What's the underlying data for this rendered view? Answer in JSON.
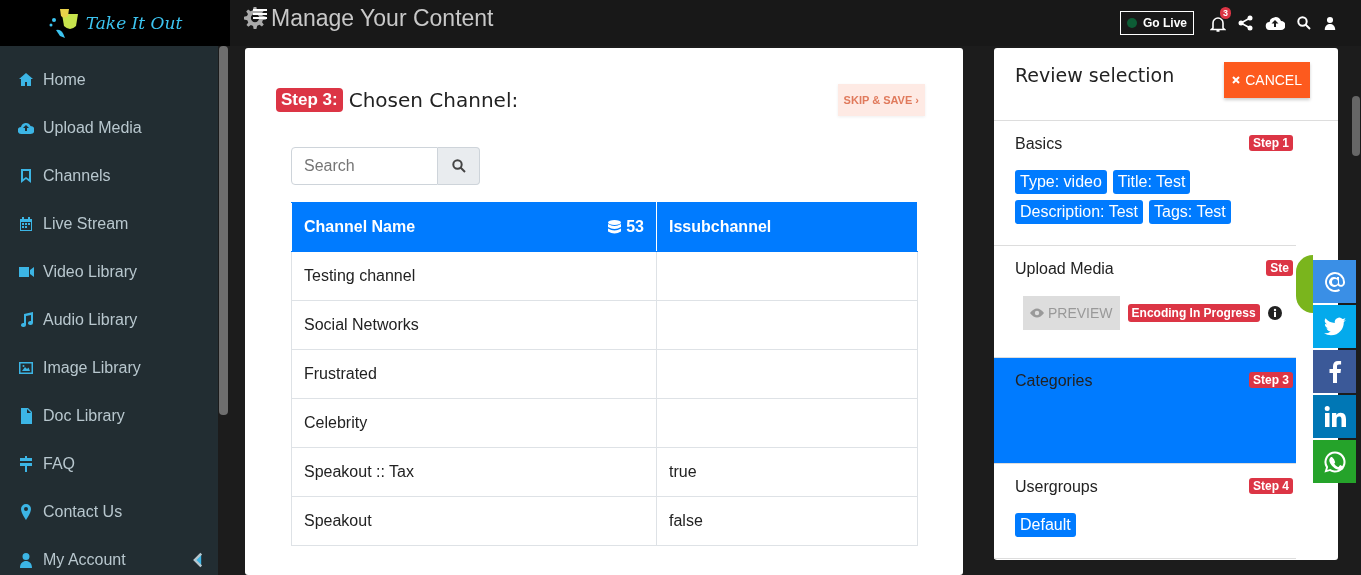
{
  "header": {
    "logo_text": "Take It Out",
    "title": "Manage Your Content",
    "go_live": {
      "label": "Go Live",
      "live": false
    },
    "notifications": "3"
  },
  "sidebar": {
    "items": [
      {
        "label": "Home",
        "selected": false
      },
      {
        "label": "Upload Media",
        "selected": false
      },
      {
        "label": "Channels",
        "selected": false
      },
      {
        "label": "Live Stream",
        "selected": false
      },
      {
        "label": "Video Library",
        "selected": false
      },
      {
        "label": "Audio Library",
        "selected": false
      },
      {
        "label": "Image Library",
        "selected": false
      },
      {
        "label": "Doc Library",
        "selected": false
      },
      {
        "label": "FAQ",
        "selected": false
      },
      {
        "label": "Contact Us",
        "selected": false
      },
      {
        "label": "My Account",
        "selected": false,
        "expanded": false
      }
    ]
  },
  "step": {
    "badge": "Step 3:",
    "title": "Chosen Channel:",
    "skip_button": {
      "label": "SKIP & SAVE ›",
      "disabled": true
    }
  },
  "search": {
    "placeholder": "Search"
  },
  "table": {
    "columns": [
      {
        "label": "Channel Name",
        "count": "53"
      },
      {
        "label": "Issubchannel"
      }
    ],
    "rows": [
      [
        "Testing channel",
        ""
      ],
      [
        "Social Networks",
        ""
      ],
      [
        "Frustrated",
        ""
      ],
      [
        "Celebrity",
        ""
      ],
      [
        "Speakout :: Tax",
        "true"
      ],
      [
        "Speakout",
        "false"
      ]
    ]
  },
  "review": {
    "title": "Review selection",
    "cancel": "CANCEL",
    "sections": [
      {
        "title": "Basics",
        "step": "Step 1",
        "selected": false,
        "kind": "tags",
        "tags": [
          "Type: video",
          "Title: Test",
          "Description: Test",
          "Tags: Test"
        ]
      },
      {
        "title": "Upload Media",
        "step": "Ste",
        "selected": false,
        "kind": "media",
        "preview": "PREVIEW",
        "status": "Encoding In Progress"
      },
      {
        "title": "Categories",
        "step": "Step 3",
        "selected": true,
        "kind": "tags"
      },
      {
        "title": "Usergroups",
        "step": "Step 4",
        "selected": false,
        "kind": "tags",
        "tags": [
          "Default"
        ]
      }
    ]
  }
}
